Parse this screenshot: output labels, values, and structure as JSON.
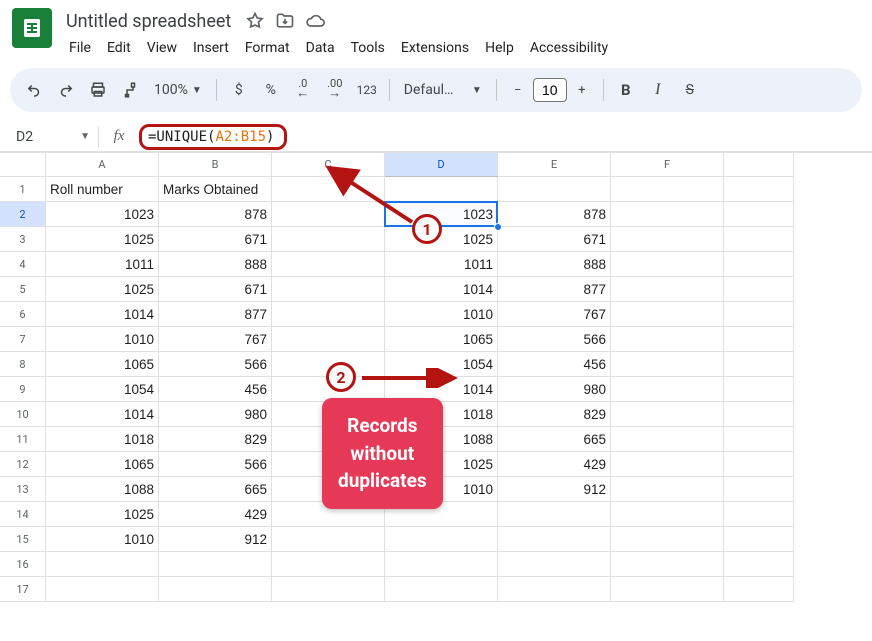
{
  "header": {
    "doc_title": "Untitled spreadsheet",
    "menus": [
      "File",
      "Edit",
      "View",
      "Insert",
      "Format",
      "Data",
      "Tools",
      "Extensions",
      "Help",
      "Accessibility"
    ]
  },
  "toolbar": {
    "zoom": "100%",
    "font_name": "Defaul…",
    "font_size": "10",
    "currency": "$",
    "percent": "%",
    "dec_dec": ".0",
    "inc_dec": ".00",
    "fmt_123": "123"
  },
  "fx": {
    "cell_ref": "D2",
    "formula_prefix": "=UNIQUE(",
    "formula_range": "A2:B15",
    "formula_suffix": ")"
  },
  "columns": [
    "A",
    "B",
    "C",
    "D",
    "E",
    "F"
  ],
  "row_count": 17,
  "headers": {
    "A1": "Roll number",
    "B1": "Marks Obtained"
  },
  "data_ab": [
    [
      1023,
      878
    ],
    [
      1025,
      671
    ],
    [
      1011,
      888
    ],
    [
      1025,
      671
    ],
    [
      1014,
      877
    ],
    [
      1010,
      767
    ],
    [
      1065,
      566
    ],
    [
      1054,
      456
    ],
    [
      1014,
      980
    ],
    [
      1018,
      829
    ],
    [
      1065,
      566
    ],
    [
      1088,
      665
    ],
    [
      1025,
      429
    ],
    [
      1010,
      912
    ]
  ],
  "data_de": [
    [
      1023,
      878
    ],
    [
      1025,
      671
    ],
    [
      1011,
      888
    ],
    [
      1014,
      877
    ],
    [
      1010,
      767
    ],
    [
      1065,
      566
    ],
    [
      1054,
      456
    ],
    [
      1014,
      980
    ],
    [
      1018,
      829
    ],
    [
      1088,
      665
    ],
    [
      1025,
      429
    ],
    [
      1010,
      912
    ]
  ],
  "active_cell": {
    "col": "D",
    "row": 2
  },
  "annotations": {
    "badge1": "1",
    "badge2": "2",
    "callout_l1": "Records",
    "callout_l2": "without",
    "callout_l3": "duplicates"
  },
  "chart_data": {
    "type": "table",
    "title": "UNIQUE function removing duplicate rows",
    "source_range": "A2:B15",
    "source_columns": [
      "Roll number",
      "Marks Obtained"
    ],
    "source_rows": [
      [
        1023,
        878
      ],
      [
        1025,
        671
      ],
      [
        1011,
        888
      ],
      [
        1025,
        671
      ],
      [
        1014,
        877
      ],
      [
        1010,
        767
      ],
      [
        1065,
        566
      ],
      [
        1054,
        456
      ],
      [
        1014,
        980
      ],
      [
        1018,
        829
      ],
      [
        1065,
        566
      ],
      [
        1088,
        665
      ],
      [
        1025,
        429
      ],
      [
        1010,
        912
      ]
    ],
    "result_range": "D2:E13",
    "result_rows": [
      [
        1023,
        878
      ],
      [
        1025,
        671
      ],
      [
        1011,
        888
      ],
      [
        1014,
        877
      ],
      [
        1010,
        767
      ],
      [
        1065,
        566
      ],
      [
        1054,
        456
      ],
      [
        1014,
        980
      ],
      [
        1018,
        829
      ],
      [
        1088,
        665
      ],
      [
        1025,
        429
      ],
      [
        1010,
        912
      ]
    ]
  }
}
